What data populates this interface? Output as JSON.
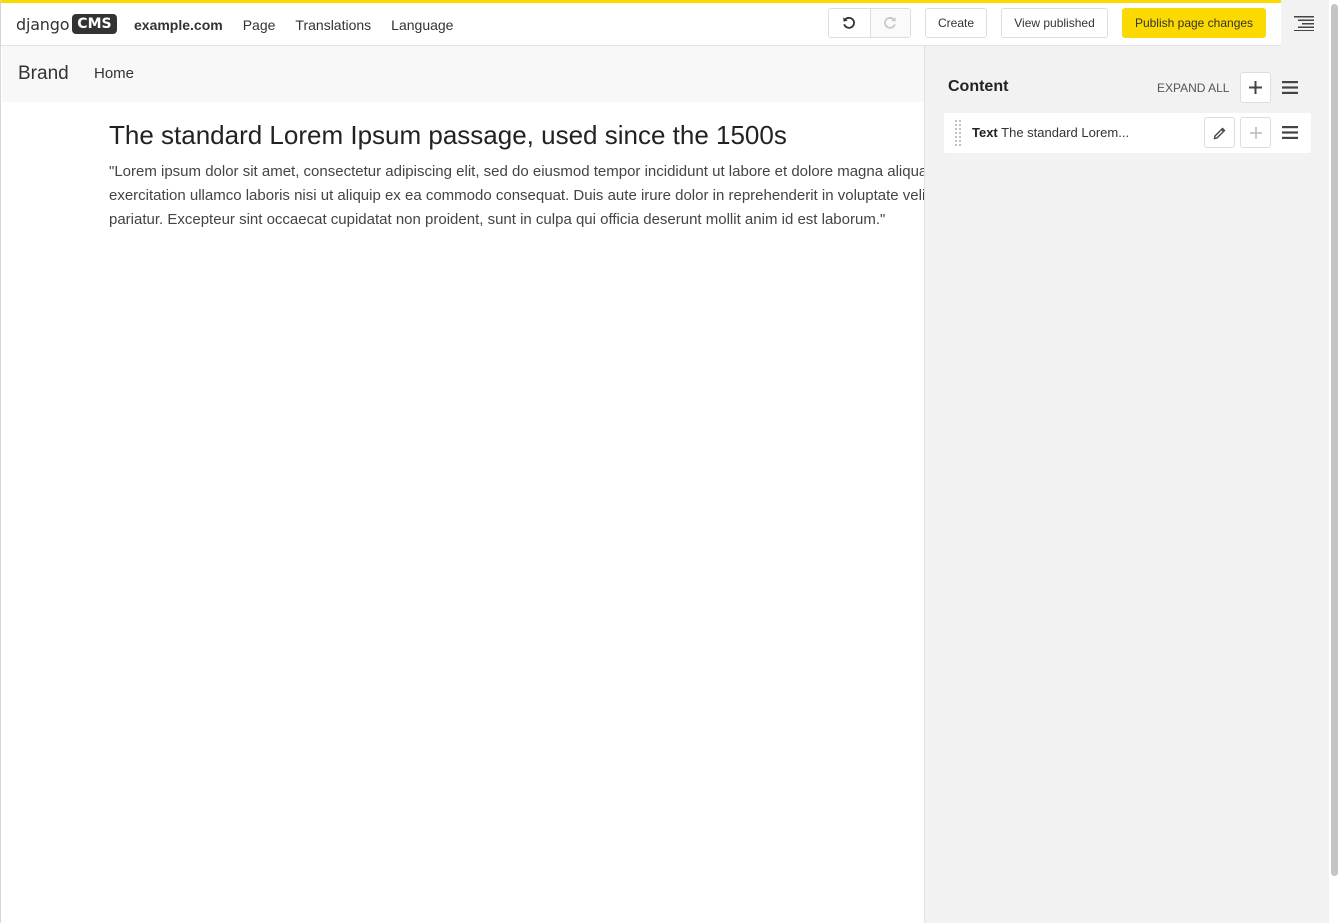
{
  "toolbar": {
    "logo_text": "django",
    "logo_badge": "CMS",
    "menu": [
      {
        "label": "example.com"
      },
      {
        "label": "Page"
      },
      {
        "label": "Translations"
      },
      {
        "label": "Language"
      }
    ],
    "create_label": "Create",
    "view_published_label": "View published",
    "publish_label": "Publish page changes",
    "accent_color": "#fcd900",
    "undo_icon": "undo-icon",
    "redo_icon": "redo-icon",
    "structure_toggle_icon": "structure-mode-icon"
  },
  "site": {
    "brand": "Brand",
    "nav_home": "Home"
  },
  "page": {
    "heading": "The standard Lorem Ipsum passage, used since the 1500s",
    "body": "\"Lorem ipsum dolor sit amet, consectetur adipiscing elit, sed do eiusmod tempor incididunt ut labore et dolore magna aliqua. Ut enim ad minim veniam, quis nostrud exercitation ullamco laboris nisi ut aliquip ex ea commodo consequat. Duis aute irure dolor in reprehenderit in voluptate velit esse cillum dolore eu fugiat nulla pariatur. Excepteur sint occaecat cupidatat non proident, sunt in culpa qui officia deserunt mollit anim id est laborum.\""
  },
  "structure": {
    "placeholder_title": "Content",
    "expand_all_label": "EXPAND ALL",
    "plugins": [
      {
        "type": "Text",
        "summary": "The standard Lorem..."
      }
    ]
  }
}
